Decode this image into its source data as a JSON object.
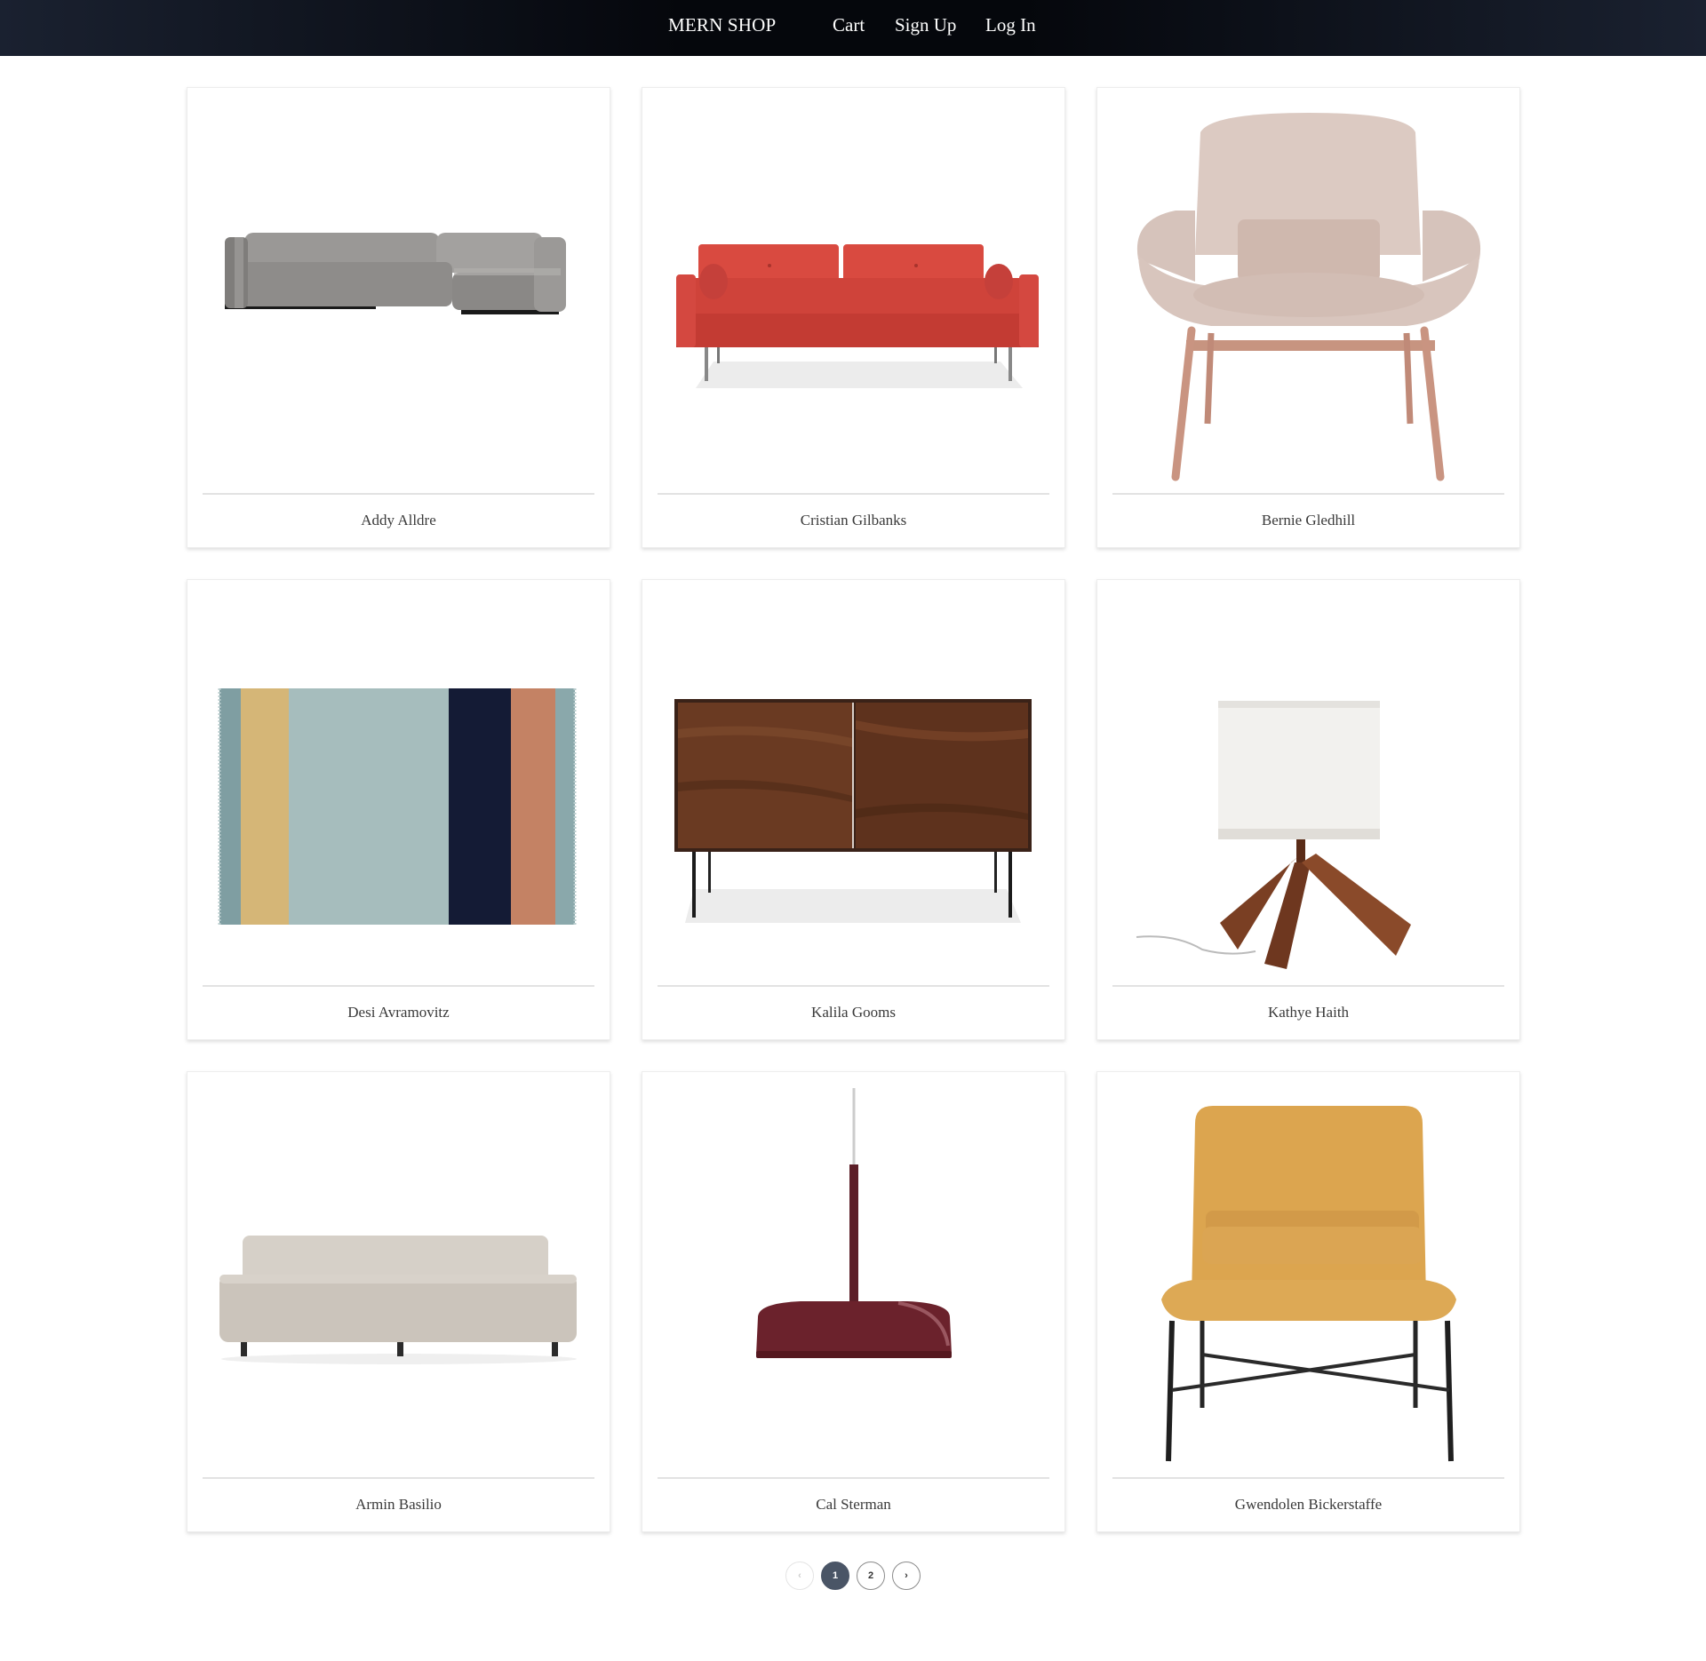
{
  "header": {
    "brand": "MERN SHOP",
    "links": {
      "cart": "Cart",
      "signup": "Sign Up",
      "login": "Log In"
    }
  },
  "products": [
    {
      "name": "Addy Alldre"
    },
    {
      "name": "Cristian Gilbanks"
    },
    {
      "name": "Bernie Gledhill"
    },
    {
      "name": "Desi Avramovitz"
    },
    {
      "name": "Kalila Gooms"
    },
    {
      "name": "Kathye Haith"
    },
    {
      "name": "Armin Basilio"
    },
    {
      "name": "Cal Sterman"
    },
    {
      "name": "Gwendolen Bickerstaffe"
    }
  ],
  "pagination": {
    "prev": "‹",
    "pages": [
      "1",
      "2"
    ],
    "current": "1",
    "next": "›"
  },
  "colors": {
    "header_bg": "#05070c",
    "active_page": "#4a5566"
  }
}
